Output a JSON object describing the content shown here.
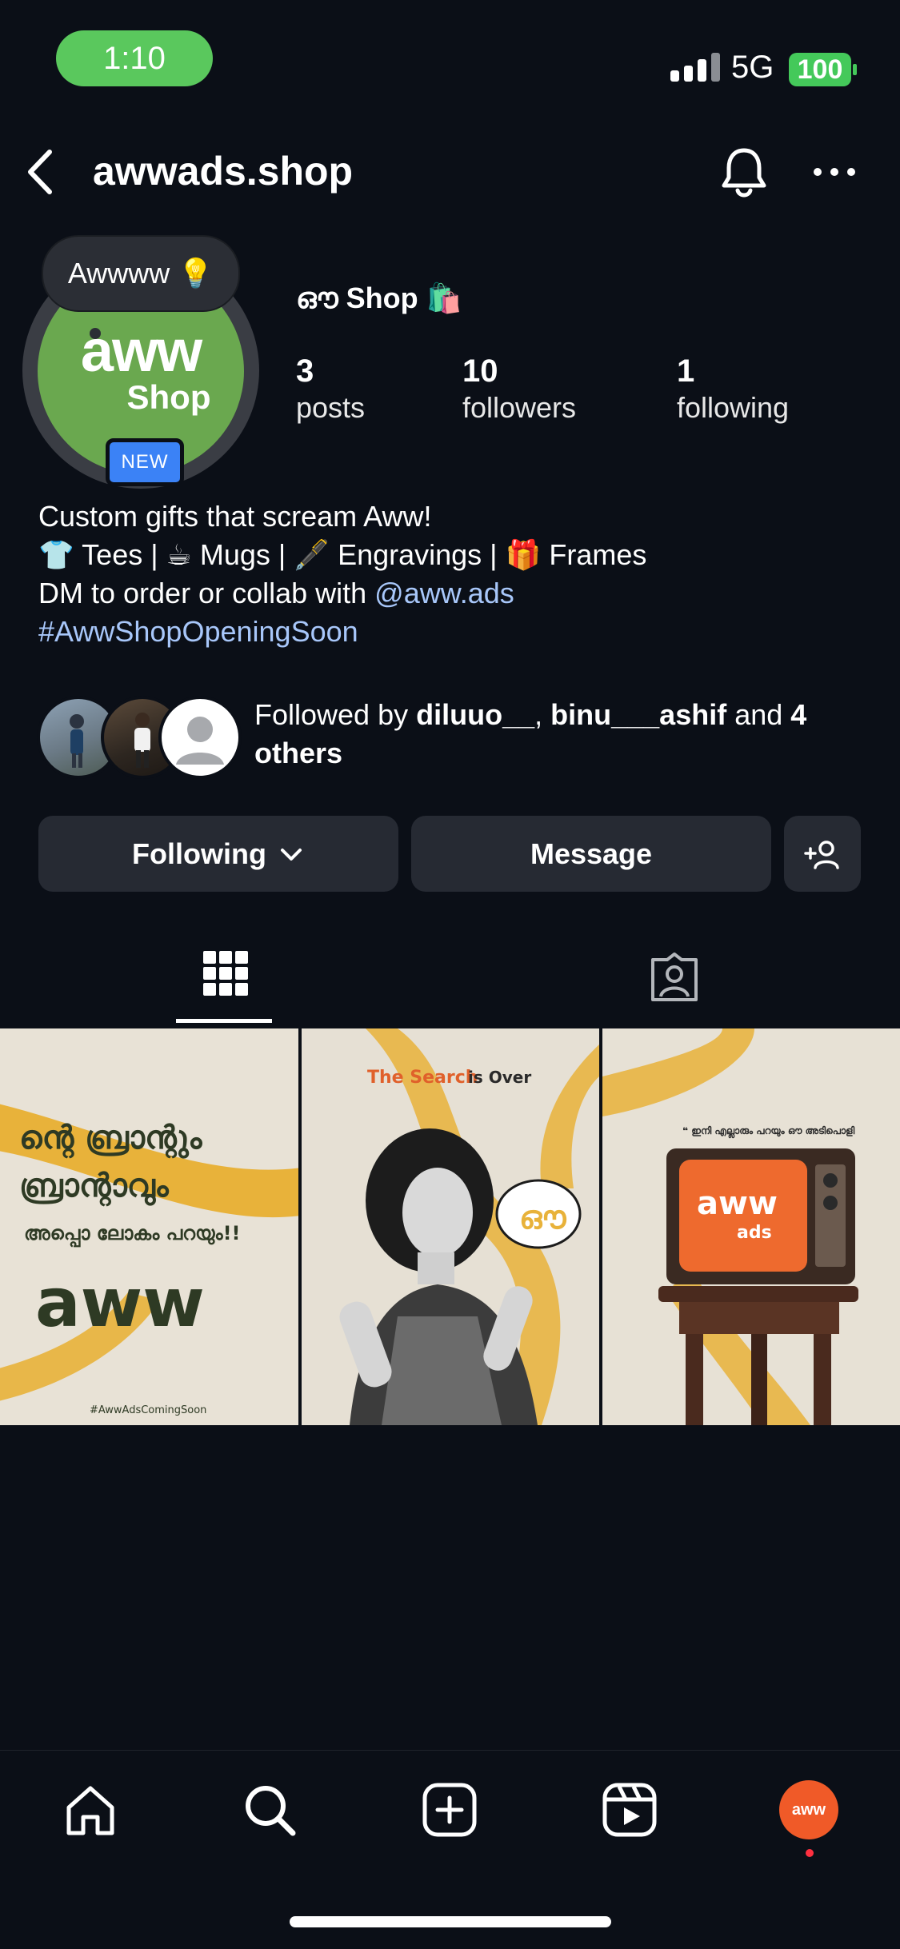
{
  "status": {
    "time": "1:10",
    "network": "5G",
    "battery": "100"
  },
  "header": {
    "username": "awwads.shop",
    "back_icon": "chevron-left-icon",
    "bell_icon": "bell-icon",
    "more_icon": "more-horizontal-icon"
  },
  "profile": {
    "note": "Awwww 💡",
    "avatar_logo_top": "aww",
    "avatar_logo_bottom": "Shop",
    "new_badge": "NEW",
    "display_name": "ഔ Shop 🛍️",
    "stats": [
      {
        "value": "3",
        "label": "posts"
      },
      {
        "value": "10",
        "label": "followers"
      },
      {
        "value": "1",
        "label": "following"
      }
    ],
    "bio": {
      "line1": "Custom gifts that scream Aww!",
      "line2": "👕 Tees | ☕ Mugs | 🖋️ Engravings | 🎁 Frames",
      "line3_prefix": "DM to order or collab with ",
      "line3_mention": "@aww.ads",
      "hashtag": "#AwwShopOpeningSoon"
    },
    "followed_by": {
      "prefix": "Followed by ",
      "user1": "diluuo__",
      "separator": ", ",
      "user2": "binu___ashif",
      "middle": " and ",
      "suffix": "4 others"
    }
  },
  "actions": {
    "following": "Following",
    "message": "Message"
  },
  "posts": [
    {
      "line1": "ന്റെ ബ്രാന്റും",
      "line2": "ബ്രാന്റാവും",
      "line3": "അപ്പൊ ലോകം പറയും!!",
      "logo": "aww",
      "hashtag": "#AwwAdsComingSoon"
    },
    {
      "headline_accent": "The Search",
      "headline_rest": " is Over",
      "bubble": "ഔ"
    },
    {
      "quote": "❝ ഇനി എല്ലാരും പറയും ഔ അടിപൊളി",
      "tv_logo_top": "aww",
      "tv_logo_bottom": "ads"
    }
  ],
  "nav": {
    "profile_logo": "aww"
  },
  "colors": {
    "background": "#0b0f17",
    "button": "#262a33",
    "link": "#a8c7fa",
    "accent_orange": "#f05a28",
    "mustard": "#e8b23a",
    "avatar_green": "#6aa84f"
  }
}
